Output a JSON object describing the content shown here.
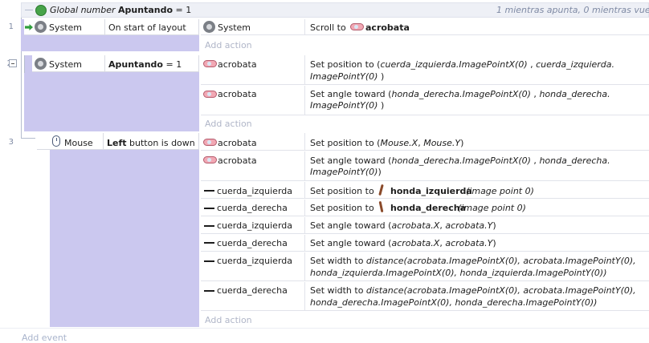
{
  "global": {
    "prefix": "Global number",
    "name": "Apuntando",
    "assign": "= 1",
    "info": "1 mientras apunta, 0 mientras vuela"
  },
  "events": [
    {
      "number": "1",
      "condition": {
        "object": "System",
        "text": "On start of layout"
      },
      "actions": [
        {
          "object": "System",
          "pre": "Scroll to",
          "target": "acrobata"
        }
      ],
      "add_action": "Add action"
    },
    {
      "number": "2",
      "condition": {
        "object": "System",
        "bold": "Apuntando",
        "rest": "= 1"
      },
      "actions": [
        {
          "object": "acrobata",
          "pre": "Set position to (",
          "l1": "cuerda_izquierda.ImagePointX(0)",
          "m1": " , ",
          "l1b": "cuerda_izquierda.",
          "l2": "ImagePointY(0)",
          "post": " )"
        },
        {
          "object": "acrobata",
          "pre": "Set angle toward (",
          "l1": "honda_derecha.ImagePointX(0)",
          "m1": "  , ",
          "l1b": "honda_derecha.",
          "l2": "ImagePointY(0)",
          "post": "  )"
        }
      ],
      "add_action": "Add action"
    },
    {
      "number": "3",
      "condition": {
        "object": "Mouse",
        "bold": "Left",
        "rest": "button is down"
      },
      "actions": [
        {
          "object": "acrobata",
          "pre": "Set position to (",
          "a": "Mouse.X",
          "m": ", ",
          "b": "Mouse.Y",
          "post": ")"
        },
        {
          "object": "acrobata",
          "pre": "Set angle toward (",
          "l1": "honda_derecha.ImagePointX(0)",
          "m1": " , ",
          "l1b": "honda_derecha.",
          "l2": "ImagePointY(0)",
          "post": ")"
        },
        {
          "object": "cuerda_izquierda",
          "pre": "Set position to",
          "target": "honda_izquierda",
          "suffix": "(image point 0)"
        },
        {
          "object": "cuerda_derecha",
          "pre": "Set position to",
          "target": "honda_derecha",
          "suffix": "(image point 0)"
        },
        {
          "object": "cuerda_izquierda",
          "pre": "Set angle toward (",
          "a": "acrobata.X",
          "m": ", ",
          "b": "acrobata.Y",
          "post": ")"
        },
        {
          "object": "cuerda_derecha",
          "pre": "Set angle toward (",
          "a": "acrobata.X",
          "m": ", ",
          "b": "acrobata.Y",
          "post": ")"
        },
        {
          "object": "cuerda_izquierda",
          "pre": "Set width to ",
          "l1": "distance(acrobata.ImagePointX(0), acrobata.ImagePointY(0),",
          "l2": "honda_izquierda.ImagePointX(0), honda_izquierda.ImagePointY(0))"
        },
        {
          "object": "cuerda_derecha",
          "pre": "Set width to ",
          "l1": "distance(acrobata.ImagePointX(0), acrobata.ImagePointY(0),",
          "l2": "honda_derecha.ImagePointX(0), honda_derecha.ImagePointY(0))"
        }
      ],
      "add_action": "Add action"
    }
  ],
  "add_event": "Add event",
  "colors": {
    "selected_bg": "#cbc8ef",
    "header_bg": "#eef0f6"
  },
  "icons": [
    "globe-icon",
    "gear-icon",
    "cloud-sprite-icon",
    "line-icon",
    "rope-sprite-icon",
    "mouse-icon",
    "arrow-icon",
    "collapse-icon"
  ]
}
